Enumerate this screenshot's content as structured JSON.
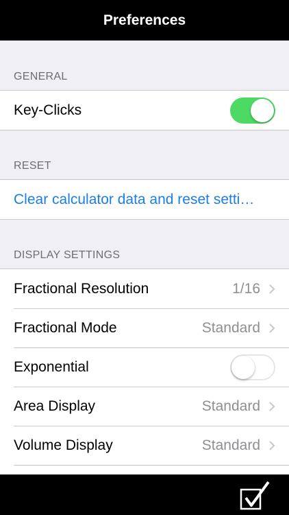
{
  "header": {
    "title": "Preferences"
  },
  "sections": {
    "general": {
      "title": "GENERAL",
      "key_clicks": {
        "label": "Key-Clicks",
        "on": true
      }
    },
    "reset": {
      "title": "RESET",
      "clear_label": "Clear calculator data and reset setti…"
    },
    "display": {
      "title": "DISPLAY SETTINGS",
      "rows": [
        {
          "label": "Fractional Resolution",
          "value": "1/16"
        },
        {
          "label": "Fractional Mode",
          "value": "Standard"
        },
        {
          "label": "Exponential",
          "on": false
        },
        {
          "label": "Area Display",
          "value": "Standard"
        },
        {
          "label": "Volume Display",
          "value": "Standard"
        }
      ]
    }
  },
  "colors": {
    "accent": "#1a7ee6",
    "toggle_on": "#4cd964",
    "navbar": "#000000",
    "background": "#efeff4"
  },
  "icons": {
    "done": "checkbox-check-icon",
    "disclosure": "chevron-right-icon"
  }
}
